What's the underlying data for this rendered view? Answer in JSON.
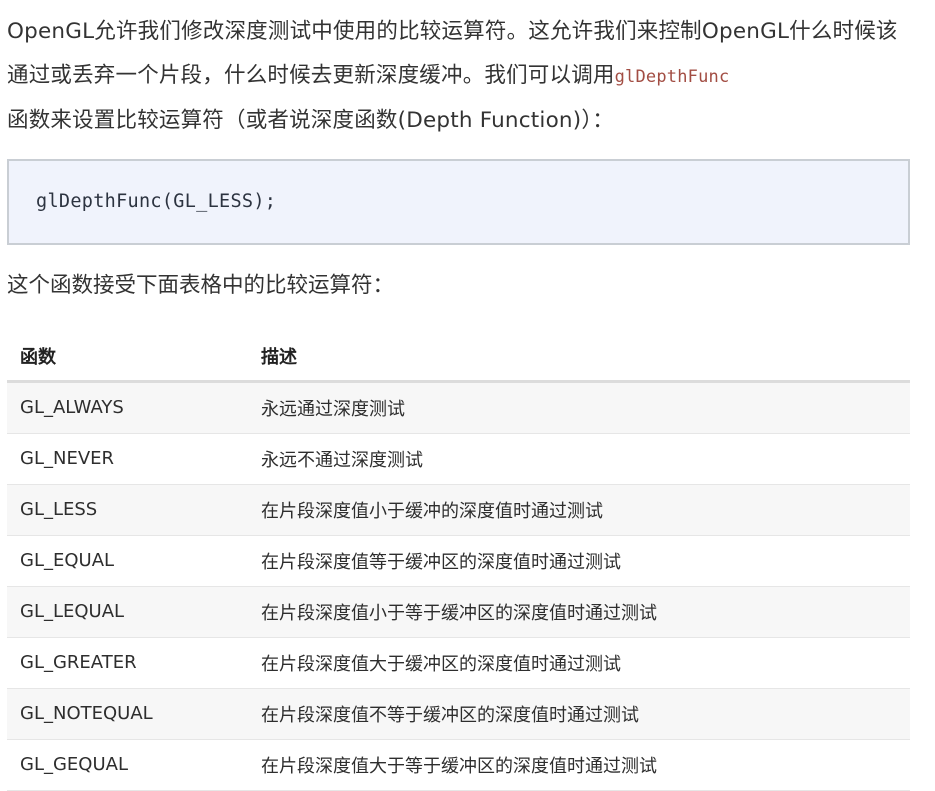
{
  "intro": {
    "before_code": "OpenGL允许我们修改深度测试中使用的比较运算符。这允许我们来控制OpenGL什么时候该通过或丢弃一个片段，什么时候去更新深度缓冲。我们可以调用",
    "inline_code": "glDepthFunc",
    "after_code": "函数来设置比较运算符（或者说深度函数(Depth Function)）："
  },
  "code_block": {
    "code": "glDepthFunc(GL_LESS);"
  },
  "lead_text": "这个函数接受下面表格中的比较运算符：",
  "table": {
    "headers": [
      "函数",
      "描述"
    ],
    "rows": [
      [
        "GL_ALWAYS",
        "永远通过深度测试"
      ],
      [
        "GL_NEVER",
        "永远不通过深度测试"
      ],
      [
        "GL_LESS",
        "在片段深度值小于缓冲的深度值时通过测试"
      ],
      [
        "GL_EQUAL",
        "在片段深度值等于缓冲区的深度值时通过测试"
      ],
      [
        "GL_LEQUAL",
        "在片段深度值小于等于缓冲区的深度值时通过测试"
      ],
      [
        "GL_GREATER",
        "在片段深度值大于缓冲区的深度值时通过测试"
      ],
      [
        "GL_NOTEQUAL",
        "在片段深度值不等于缓冲区的深度值时通过测试"
      ],
      [
        "GL_GEQUAL",
        "在片段深度值大于等于缓冲区的深度值时通过测试"
      ]
    ]
  }
}
